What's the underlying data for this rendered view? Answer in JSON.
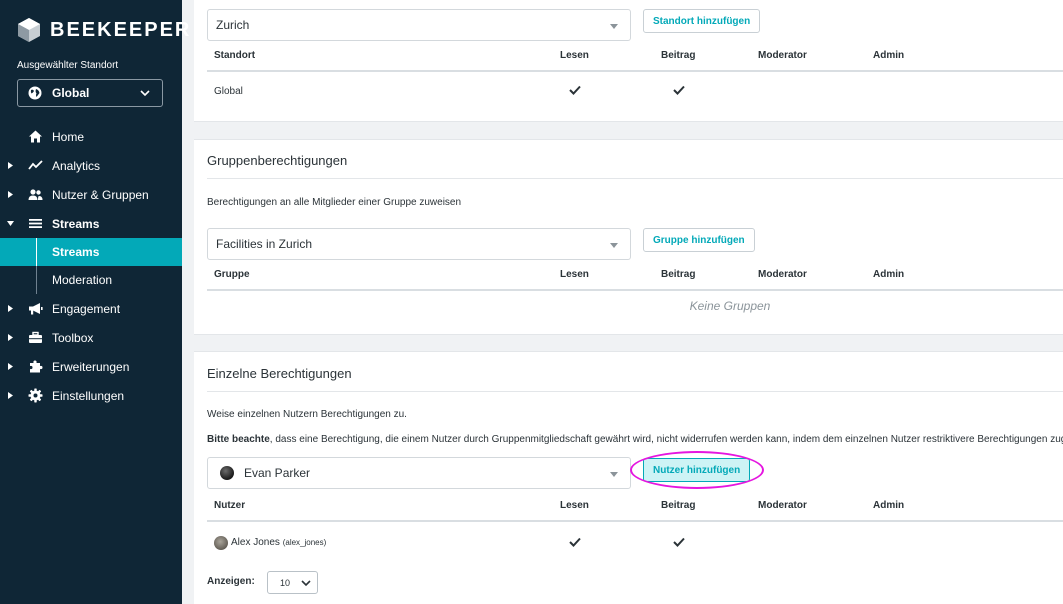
{
  "brand": {
    "name": "BEEKEEPER"
  },
  "sidebar": {
    "location_label": "Ausgewählter Standort",
    "location_value": "Global",
    "items": [
      {
        "label": "Home",
        "icon": "home-icon"
      },
      {
        "label": "Analytics",
        "icon": "analytics-icon"
      },
      {
        "label": "Nutzer & Gruppen",
        "icon": "users-icon"
      },
      {
        "label": "Streams",
        "icon": "streams-icon"
      },
      {
        "label": "Engagement",
        "icon": "megaphone-icon"
      },
      {
        "label": "Toolbox",
        "icon": "toolbox-icon"
      },
      {
        "label": "Erweiterungen",
        "icon": "puzzle-icon"
      },
      {
        "label": "Einstellungen",
        "icon": "gear-icon"
      }
    ],
    "sub_items": [
      {
        "label": "Streams",
        "active": true
      },
      {
        "label": "Moderation",
        "active": false
      }
    ]
  },
  "location_panel": {
    "select_value": "Zurich",
    "add_button": "Standort hinzufügen",
    "columns": [
      "Standort",
      "Lesen",
      "Beitrag",
      "Moderator",
      "Admin"
    ],
    "rows": [
      {
        "name": "Global",
        "lesen": true,
        "beitrag": true
      }
    ]
  },
  "group_panel": {
    "title": "Gruppenberechtigungen",
    "description": "Berechtigungen an alle Mitglieder einer Gruppe zuweisen",
    "select_value": "Facilities in Zurich",
    "add_button": "Gruppe hinzufügen",
    "columns": [
      "Gruppe",
      "Lesen",
      "Beitrag",
      "Moderator",
      "Admin"
    ],
    "empty_text": "Keine Gruppen"
  },
  "user_panel": {
    "title": "Einzelne Berechtigungen",
    "description": "Weise einzelnen Nutzern Berechtigungen zu.",
    "note_bold": "Bitte beachte",
    "note_rest": ", dass eine Berechtigung, die einem Nutzer durch Gruppenmitgliedschaft gewährt wird, nicht widerrufen werden kann, indem dem einzelnen Nutzer restriktivere Berechtigungen zugewiesen werden.",
    "select_value": "Evan Parker",
    "add_button": "Nutzer hinzufügen",
    "columns": [
      "Nutzer",
      "Lesen",
      "Beitrag",
      "Moderator",
      "Admin"
    ],
    "rows": [
      {
        "name": "Alex Jones",
        "username": "(alex_jones)",
        "lesen": true,
        "beitrag": true
      }
    ],
    "show_label": "Anzeigen:",
    "show_value": "10"
  },
  "colors": {
    "sidebar_bg": "#0f2636",
    "accent": "#03a9b8",
    "highlight_ring": "#e516e0"
  }
}
